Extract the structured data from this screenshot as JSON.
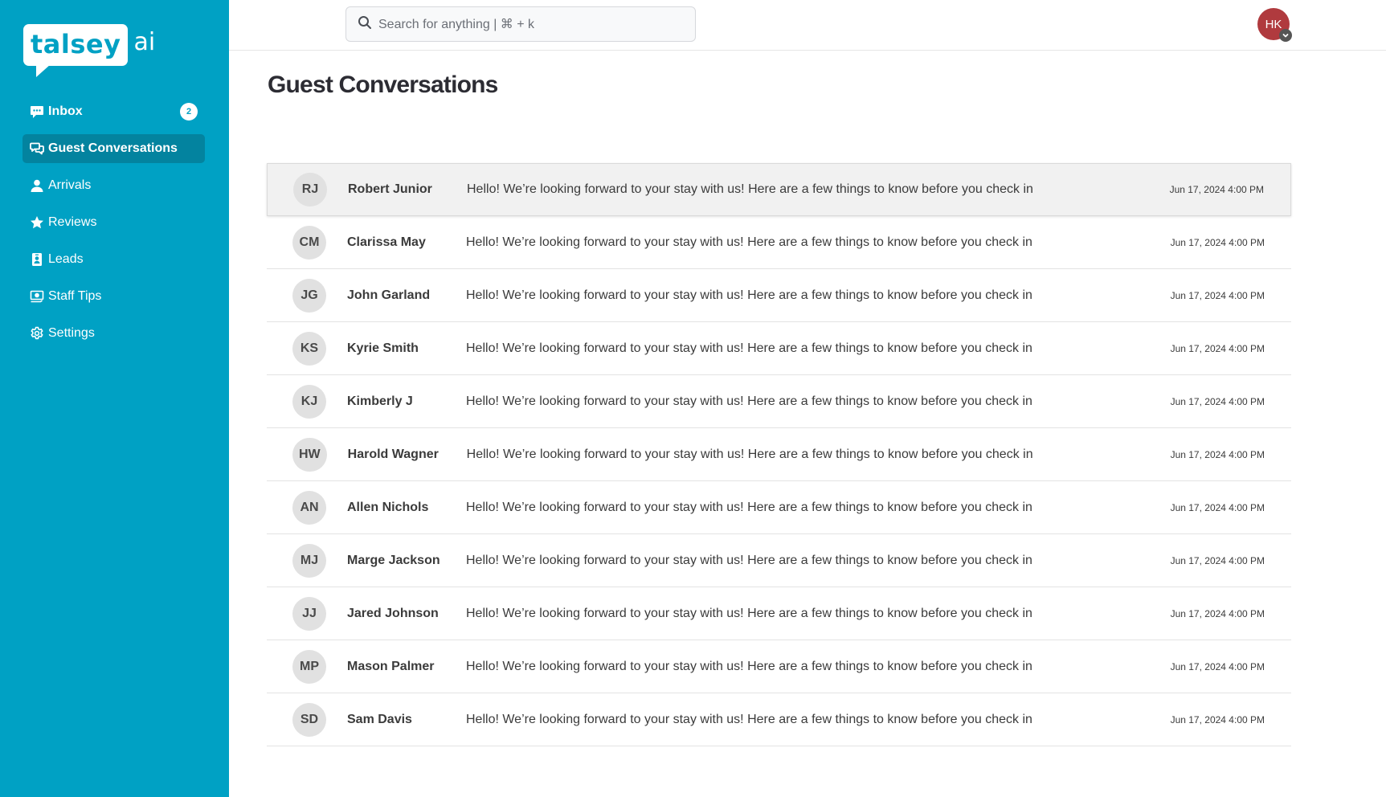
{
  "app": {
    "logo_word": "talsey",
    "logo_suffix": "ai"
  },
  "sidebar": {
    "items": [
      {
        "label": "Inbox",
        "icon": "chat-bubble-dots-icon",
        "badge": "2",
        "active": false
      },
      {
        "label": "Guest Conversations",
        "icon": "chat-bubbles-icon",
        "active": true
      },
      {
        "label": "Arrivals",
        "icon": "person-icon",
        "active": false
      },
      {
        "label": "Reviews",
        "icon": "star-icon",
        "active": false
      },
      {
        "label": "Leads",
        "icon": "id-badge-icon",
        "active": false
      },
      {
        "label": "Staff Tips",
        "icon": "money-tip-icon",
        "active": false
      },
      {
        "label": "Settings",
        "icon": "gear-icon",
        "active": false
      }
    ]
  },
  "header": {
    "search_placeholder": "Search for anything  |  ⌘ + k",
    "user_initials": "HK"
  },
  "page": {
    "title": "Guest Conversations"
  },
  "conversations": [
    {
      "initials": "RJ",
      "name": "Robert Junior",
      "message": "Hello! We’re looking forward to your stay with us! Here are a few things to know before you check in",
      "date": "Jun 17, 2024 4:00 PM",
      "selected": true
    },
    {
      "initials": "CM",
      "name": "Clarissa May",
      "message": "Hello! We’re looking forward to your stay with us! Here are a few things to know before you check in",
      "date": "Jun 17, 2024 4:00 PM"
    },
    {
      "initials": "JG",
      "name": "John Garland",
      "message": "Hello! We’re looking forward to your stay with us! Here are a few things to know before you check in",
      "date": "Jun 17, 2024 4:00 PM"
    },
    {
      "initials": "KS",
      "name": "Kyrie Smith",
      "message": "Hello! We’re looking forward to your stay with us! Here are a few things to know before you check in",
      "date": "Jun 17, 2024 4:00 PM"
    },
    {
      "initials": "KJ",
      "name": "Kimberly J",
      "message": "Hello! We’re looking forward to your stay with us! Here are a few things to know before you check in",
      "date": "Jun 17, 2024 4:00 PM"
    },
    {
      "initials": "HW",
      "name": "Harold Wagner",
      "message": "Hello! We’re looking forward to your stay with us! Here are a few things to know before you check in",
      "date": "Jun 17, 2024 4:00 PM"
    },
    {
      "initials": "AN",
      "name": "Allen Nichols",
      "message": "Hello! We’re looking forward to your stay with us! Here are a few things to know before you check in",
      "date": "Jun 17, 2024 4:00 PM"
    },
    {
      "initials": "MJ",
      "name": "Marge Jackson",
      "message": "Hello! We’re looking forward to your stay with us! Here are a few things to know before you check in",
      "date": "Jun 17, 2024 4:00 PM"
    },
    {
      "initials": "JJ",
      "name": "Jared Johnson",
      "message": "Hello! We’re looking forward to your stay with us! Here are a few things to know before you check in",
      "date": "Jun 17, 2024 4:00 PM"
    },
    {
      "initials": "MP",
      "name": "Mason Palmer",
      "message": "Hello! We’re looking forward to your stay with us! Here are a few things to know before you check in",
      "date": "Jun 17, 2024 4:00 PM"
    },
    {
      "initials": "SD",
      "name": "Sam Davis",
      "message": "Hello! We’re looking forward to your stay with us! Here are a few things to know before you check in",
      "date": "Jun 17, 2024 4:00 PM"
    }
  ],
  "colors": {
    "sidebar_bg": "#00a1c4",
    "sidebar_active": "#03839f",
    "user_avatar": "#b03a3e"
  }
}
